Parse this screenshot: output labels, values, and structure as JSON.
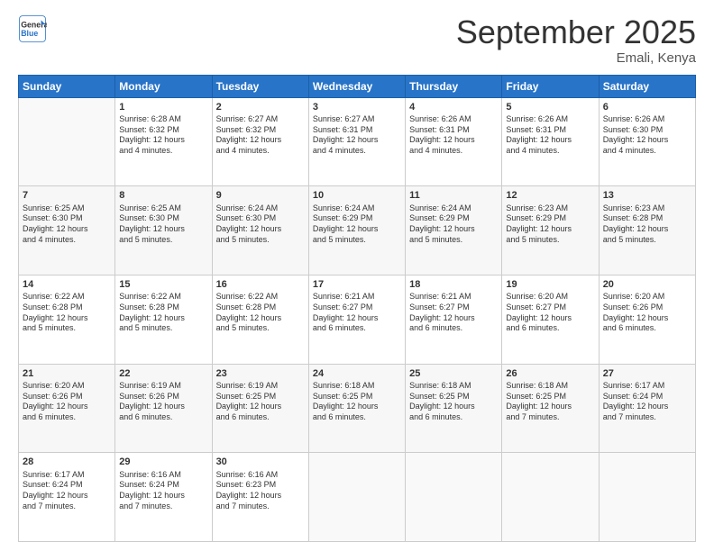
{
  "logo": {
    "line1": "General",
    "line2": "Blue"
  },
  "title": "September 2025",
  "location": "Emali, Kenya",
  "days_of_week": [
    "Sunday",
    "Monday",
    "Tuesday",
    "Wednesday",
    "Thursday",
    "Friday",
    "Saturday"
  ],
  "weeks": [
    [
      {
        "day": "",
        "info": ""
      },
      {
        "day": "1",
        "info": "Sunrise: 6:28 AM\nSunset: 6:32 PM\nDaylight: 12 hours\nand 4 minutes."
      },
      {
        "day": "2",
        "info": "Sunrise: 6:27 AM\nSunset: 6:32 PM\nDaylight: 12 hours\nand 4 minutes."
      },
      {
        "day": "3",
        "info": "Sunrise: 6:27 AM\nSunset: 6:31 PM\nDaylight: 12 hours\nand 4 minutes."
      },
      {
        "day": "4",
        "info": "Sunrise: 6:26 AM\nSunset: 6:31 PM\nDaylight: 12 hours\nand 4 minutes."
      },
      {
        "day": "5",
        "info": "Sunrise: 6:26 AM\nSunset: 6:31 PM\nDaylight: 12 hours\nand 4 minutes."
      },
      {
        "day": "6",
        "info": "Sunrise: 6:26 AM\nSunset: 6:30 PM\nDaylight: 12 hours\nand 4 minutes."
      }
    ],
    [
      {
        "day": "7",
        "info": "Sunrise: 6:25 AM\nSunset: 6:30 PM\nDaylight: 12 hours\nand 4 minutes."
      },
      {
        "day": "8",
        "info": "Sunrise: 6:25 AM\nSunset: 6:30 PM\nDaylight: 12 hours\nand 5 minutes."
      },
      {
        "day": "9",
        "info": "Sunrise: 6:24 AM\nSunset: 6:30 PM\nDaylight: 12 hours\nand 5 minutes."
      },
      {
        "day": "10",
        "info": "Sunrise: 6:24 AM\nSunset: 6:29 PM\nDaylight: 12 hours\nand 5 minutes."
      },
      {
        "day": "11",
        "info": "Sunrise: 6:24 AM\nSunset: 6:29 PM\nDaylight: 12 hours\nand 5 minutes."
      },
      {
        "day": "12",
        "info": "Sunrise: 6:23 AM\nSunset: 6:29 PM\nDaylight: 12 hours\nand 5 minutes."
      },
      {
        "day": "13",
        "info": "Sunrise: 6:23 AM\nSunset: 6:28 PM\nDaylight: 12 hours\nand 5 minutes."
      }
    ],
    [
      {
        "day": "14",
        "info": "Sunrise: 6:22 AM\nSunset: 6:28 PM\nDaylight: 12 hours\nand 5 minutes."
      },
      {
        "day": "15",
        "info": "Sunrise: 6:22 AM\nSunset: 6:28 PM\nDaylight: 12 hours\nand 5 minutes."
      },
      {
        "day": "16",
        "info": "Sunrise: 6:22 AM\nSunset: 6:28 PM\nDaylight: 12 hours\nand 5 minutes."
      },
      {
        "day": "17",
        "info": "Sunrise: 6:21 AM\nSunset: 6:27 PM\nDaylight: 12 hours\nand 6 minutes."
      },
      {
        "day": "18",
        "info": "Sunrise: 6:21 AM\nSunset: 6:27 PM\nDaylight: 12 hours\nand 6 minutes."
      },
      {
        "day": "19",
        "info": "Sunrise: 6:20 AM\nSunset: 6:27 PM\nDaylight: 12 hours\nand 6 minutes."
      },
      {
        "day": "20",
        "info": "Sunrise: 6:20 AM\nSunset: 6:26 PM\nDaylight: 12 hours\nand 6 minutes."
      }
    ],
    [
      {
        "day": "21",
        "info": "Sunrise: 6:20 AM\nSunset: 6:26 PM\nDaylight: 12 hours\nand 6 minutes."
      },
      {
        "day": "22",
        "info": "Sunrise: 6:19 AM\nSunset: 6:26 PM\nDaylight: 12 hours\nand 6 minutes."
      },
      {
        "day": "23",
        "info": "Sunrise: 6:19 AM\nSunset: 6:25 PM\nDaylight: 12 hours\nand 6 minutes."
      },
      {
        "day": "24",
        "info": "Sunrise: 6:18 AM\nSunset: 6:25 PM\nDaylight: 12 hours\nand 6 minutes."
      },
      {
        "day": "25",
        "info": "Sunrise: 6:18 AM\nSunset: 6:25 PM\nDaylight: 12 hours\nand 6 minutes."
      },
      {
        "day": "26",
        "info": "Sunrise: 6:18 AM\nSunset: 6:25 PM\nDaylight: 12 hours\nand 7 minutes."
      },
      {
        "day": "27",
        "info": "Sunrise: 6:17 AM\nSunset: 6:24 PM\nDaylight: 12 hours\nand 7 minutes."
      }
    ],
    [
      {
        "day": "28",
        "info": "Sunrise: 6:17 AM\nSunset: 6:24 PM\nDaylight: 12 hours\nand 7 minutes."
      },
      {
        "day": "29",
        "info": "Sunrise: 6:16 AM\nSunset: 6:24 PM\nDaylight: 12 hours\nand 7 minutes."
      },
      {
        "day": "30",
        "info": "Sunrise: 6:16 AM\nSunset: 6:23 PM\nDaylight: 12 hours\nand 7 minutes."
      },
      {
        "day": "",
        "info": ""
      },
      {
        "day": "",
        "info": ""
      },
      {
        "day": "",
        "info": ""
      },
      {
        "day": "",
        "info": ""
      }
    ]
  ]
}
